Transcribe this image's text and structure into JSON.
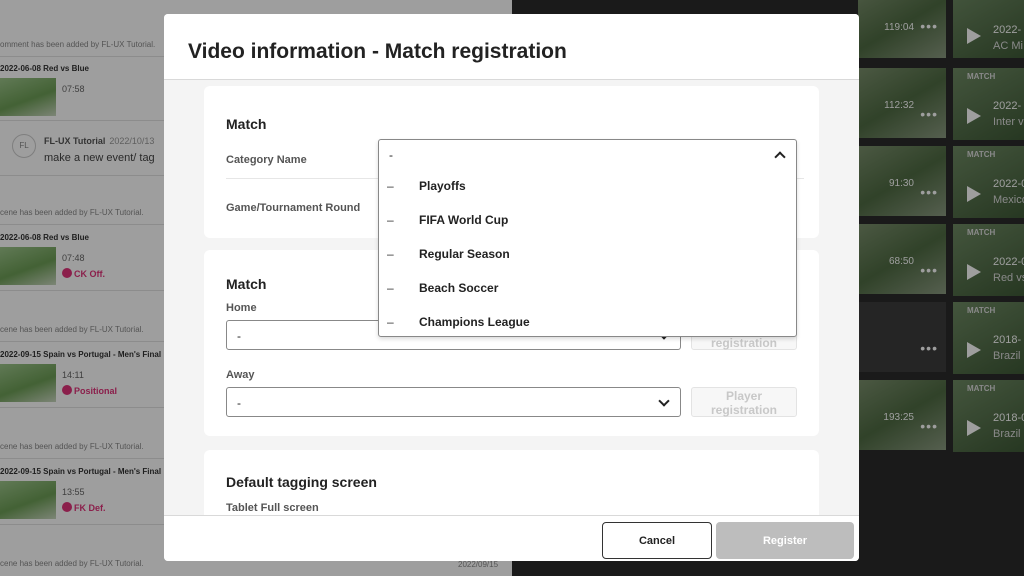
{
  "background": {
    "feed": [
      {
        "note": "omment has been added by FL-UX Tutorial."
      },
      {
        "title": "2022-06-08 Red vs Blue",
        "time": "07:58"
      },
      {
        "comment_author": "FL-UX Tutorial",
        "comment_date": "2022/10/13",
        "comment_text": "make a new event/ tag",
        "avatar": "FL"
      },
      {
        "note": "cene has been added by FL-UX Tutorial."
      },
      {
        "title": "2022-06-08 Red vs Blue",
        "time": "07:48",
        "tag": "CK Off."
      },
      {
        "note": "cene has been added by FL-UX Tutorial."
      },
      {
        "title": "2022-09-15 Spain vs Portugal - Men's Final",
        "time": "14:11",
        "tag": "Positional"
      },
      {
        "note": "cene has been added by FL-UX Tutorial."
      },
      {
        "title": "2022-09-15 Spain vs Portugal - Men's Final",
        "time": "13:55",
        "tag": "FK Def."
      },
      {
        "note": "cene has been added by FL-UX Tutorial.",
        "date": "2022/09/15"
      }
    ],
    "videos": [
      {
        "duration": "119:04",
        "more": "•••",
        "card_type": "",
        "card_title": "2022-",
        "card_sub": "AC Mi"
      },
      {
        "duration": "112:32",
        "more": "•••",
        "card_type": "MATCH",
        "card_title": "2022-",
        "card_sub": "Inter v"
      },
      {
        "duration": "91:30",
        "more": "•••",
        "card_type": "MATCH",
        "card_title": "2022-0",
        "card_sub": "Mexico"
      },
      {
        "duration": "68:50",
        "more": "•••",
        "card_type": "MATCH",
        "card_title": "2022-0",
        "card_sub": "Red vs"
      },
      {
        "duration": "",
        "more": "•••",
        "card_type": "MATCH",
        "card_title": "2018-",
        "card_sub": "Brazil"
      },
      {
        "duration": "193:25",
        "more": "•••",
        "card_type": "MATCH",
        "card_title": "2018-0",
        "card_sub": "Brazil"
      }
    ]
  },
  "modal": {
    "title": "Video information - Match registration",
    "section1": {
      "title": "Match",
      "category_label": "Category Name",
      "round_label": "Game/Tournament Round",
      "category_value": "-"
    },
    "dropdown": {
      "options": [
        "Playoffs",
        "FIFA World Cup",
        "Regular Season",
        "Beach Soccer",
        "Champions League"
      ],
      "dash": "–"
    },
    "section2": {
      "title": "Match",
      "home_label": "Home",
      "home_value": "-",
      "away_label": "Away",
      "away_value": "-",
      "player_registration_label": "Player registration"
    },
    "section3": {
      "title": "Default tagging screen",
      "screen_label": "Tablet Full screen"
    },
    "footer": {
      "cancel_label": "Cancel",
      "register_label": "Register"
    }
  }
}
